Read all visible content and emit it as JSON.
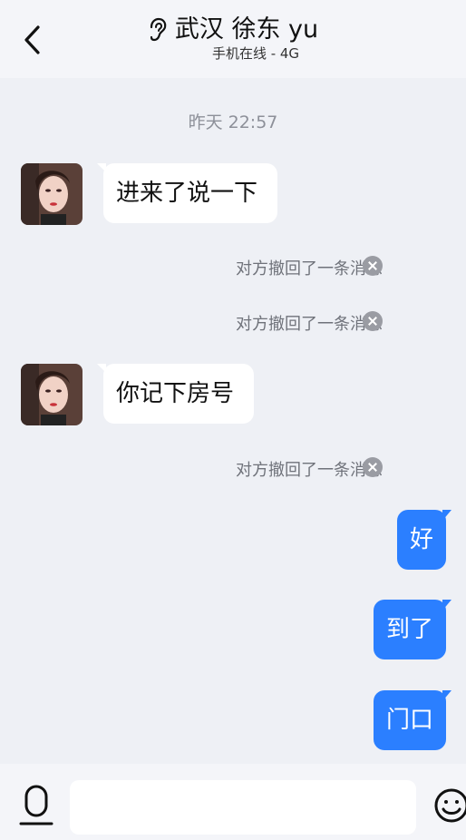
{
  "header": {
    "title": "武汉 徐东 yu",
    "subtitle": "手机在线 - 4G"
  },
  "timestamp": "昨天 22:57",
  "messages": {
    "m1": "进来了说一下",
    "recall1": "对方撤回了一条消息",
    "recall2": "对方撤回了一条消息",
    "m2": "你记下房号",
    "recall3": "对方撤回了一条消息",
    "m3": "好",
    "m4": "到了",
    "m5": "门口"
  },
  "colors": {
    "outgoing_bubble": "#2b7fff",
    "incoming_bubble": "#ffffff",
    "background": "#eef0f5"
  },
  "icons": [
    "back-icon",
    "ear-icon",
    "microphone-icon",
    "emoji-icon",
    "close-circle-icon"
  ],
  "input": {
    "value": "",
    "placeholder": ""
  }
}
